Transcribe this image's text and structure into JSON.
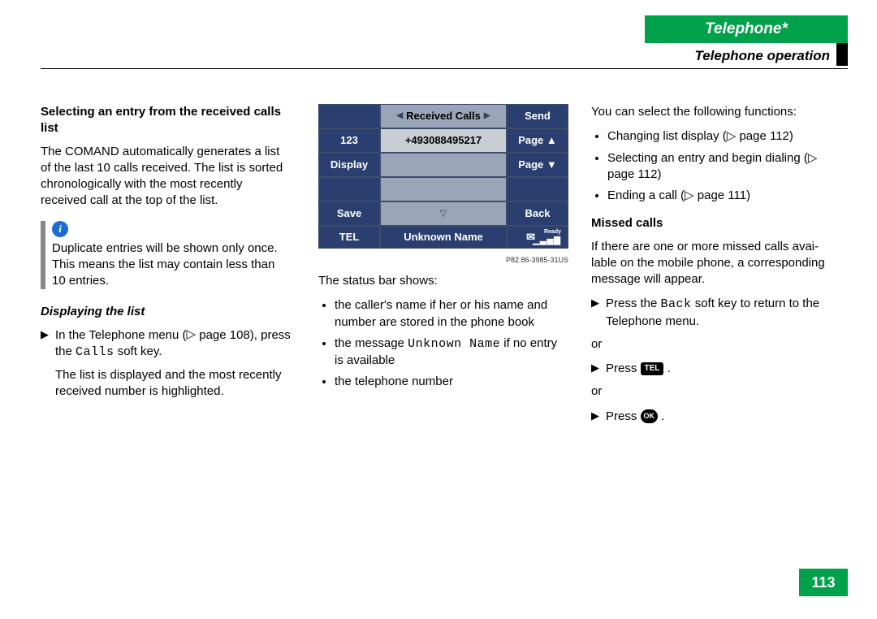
{
  "header": {
    "chapter": "Telephone*",
    "section": "Telephone operation"
  },
  "col1": {
    "h1": "Selecting an entry from the received calls list",
    "p1": "The COMAND automatically generates a list of the last 10 calls received. The list is sorted chronologically with the most recently received call at the top of the list.",
    "info": "Duplicate entries will be shown only once. This means the list may contain less than 10 entries.",
    "h2": "Displaying the list",
    "step1a": "In the Telephone menu (",
    "step1b": " page 108), press the ",
    "step1c": "Calls",
    "step1d": " soft key.",
    "step2": "The list is displayed and the most recently received number is highlighted."
  },
  "device": {
    "title": "Received Calls",
    "number": "+493088495217",
    "sk": {
      "send": "Send",
      "123": "123",
      "pageup": "Page ▲",
      "display": "Display",
      "pagedn": "Page ▼",
      "save": "Save",
      "back": "Back"
    },
    "status_mode": "TEL",
    "status_name": "Unknown Name",
    "status_ready": "Ready",
    "partno": "P82.86-3985-31US"
  },
  "col2": {
    "lead": "The status bar shows:",
    "b1": "the caller's name if her or his name and number are stored in the phone book",
    "b2a": "the message ",
    "b2b": "Unknown Name",
    "b2c": " if no entry is available",
    "b3": "the telephone number"
  },
  "col3": {
    "lead": "You can select the following functions:",
    "b1": "Changing list display (▷ page 112)",
    "b2": "Selecting an entry and begin dialing (▷ page 112)",
    "b3": "Ending a call (▷ page 111)",
    "h": "Missed calls",
    "p": "If there are one or more missed calls avai­lable on the mobile phone, a correspon­ding message will appear.",
    "s1a": "Press the ",
    "s1b": "Back",
    "s1c": " soft key to return to the Telephone menu.",
    "or": "or",
    "s2": "Press ",
    "s3": "Press "
  },
  "page_number": "113"
}
